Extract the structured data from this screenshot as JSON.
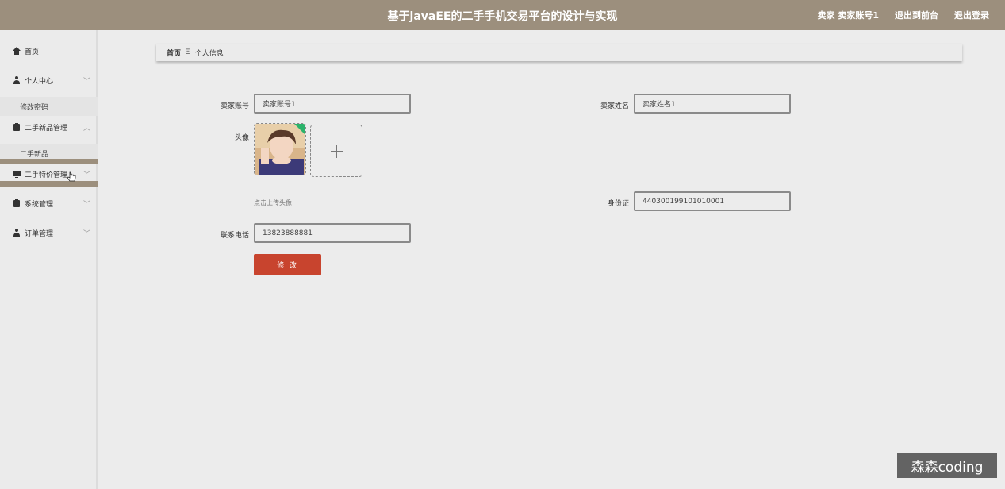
{
  "header": {
    "title": "基于javaEE的二手手机交易平台的设计与实现",
    "user_role": "卖家",
    "username": "卖家账号1",
    "back_to_front": "退出到前台",
    "logout": "退出登录"
  },
  "sidebar": {
    "home": "首页",
    "personal_center": "个人中心",
    "change_password": "修改密码",
    "new_goods_mgmt": "二手新品管理",
    "new_goods": "二手新品",
    "special_goods_mgmt": "二手特价管理",
    "system_mgmt": "系统管理",
    "order_mgmt": "订单管理"
  },
  "breadcrumb": {
    "home": "首页",
    "separator": "Ξ",
    "current": "个人信息"
  },
  "form": {
    "account_label": "卖家账号",
    "account_value": "卖家账号1",
    "name_label": "卖家姓名",
    "name_value": "卖家姓名1",
    "avatar_label": "头像",
    "avatar_hint": "点击上传头像",
    "id_label": "身份证",
    "id_value": "440300199101010001",
    "phone_label": "联系电话",
    "phone_value": "13823888881",
    "submit": "修 改"
  },
  "watermark": "森森coding",
  "colors": {
    "header_bg": "#9c8f7d",
    "button_bg": "#c8442e",
    "page_bg": "#ececec"
  }
}
